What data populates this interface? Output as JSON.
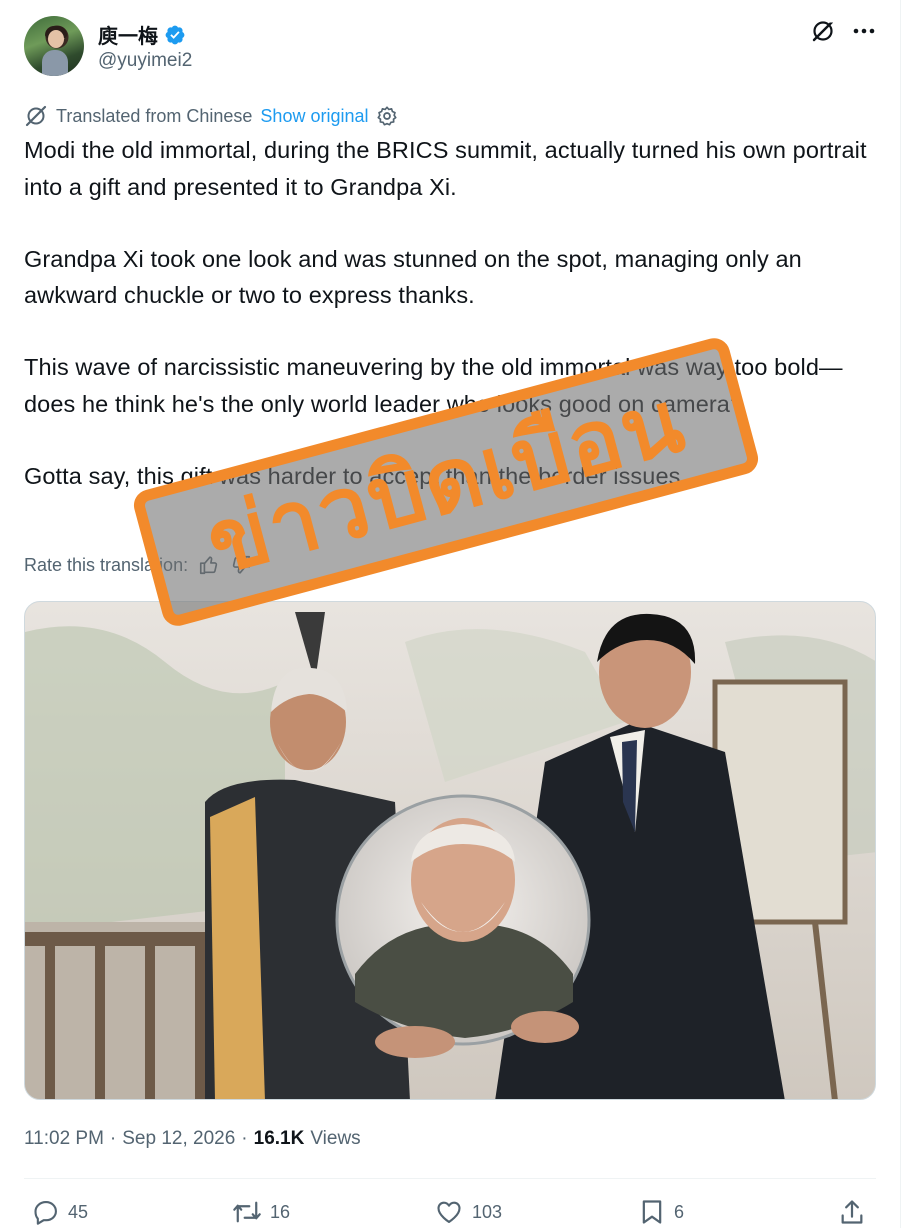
{
  "author": {
    "display_name": "庾一梅",
    "handle": "@yuyimei2"
  },
  "translation": {
    "notice": "Translated from Chinese",
    "show_original": "Show original",
    "rate_label": "Rate this translation:"
  },
  "tweet": {
    "paragraphs": [
      "Modi the old immortal, during the BRICS summit, actually turned his own portrait into a gift and presented it to Grandpa Xi.",
      "Grandpa Xi took one look and was stunned on the spot, managing only an awkward chuckle or two to express thanks.",
      "This wave of narcissistic maneuvering by the old immortal was way too bold—does he think he's the only world leader who looks good on camera?",
      "Gotta say, this gift was harder to accept than the border issues."
    ]
  },
  "overlay": {
    "stamp_text": "ข่าวบิดเบือน",
    "stamp_color": "#f28a2b"
  },
  "meta": {
    "time": "11:02 PM",
    "separator": "·",
    "date": "Sep 12, 2026",
    "views_count": "16.1K",
    "views_label": "Views"
  },
  "actions": {
    "replies": "45",
    "reposts": "16",
    "likes": "103",
    "bookmarks": "6"
  },
  "colors": {
    "accent": "#1d9bf0",
    "secondary_text": "#536471",
    "primary_text": "#0f1419"
  }
}
